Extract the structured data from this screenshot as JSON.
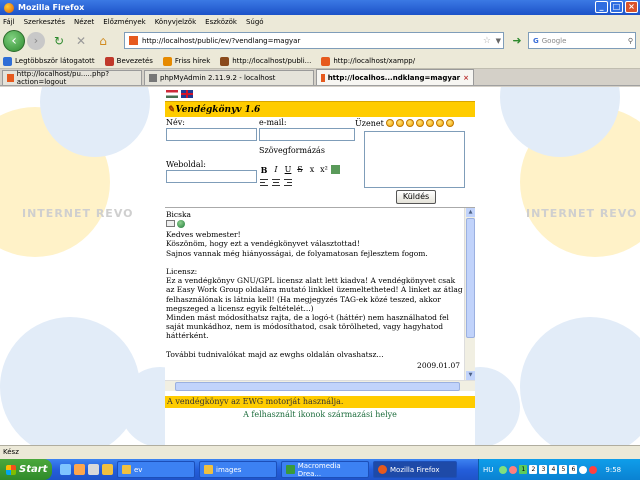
{
  "window": {
    "title": "Mozilla Firefox"
  },
  "menu": [
    "Fájl",
    "Szerkesztés",
    "Nézet",
    "Előzmények",
    "Könyvjelzők",
    "Eszközök",
    "Súgó"
  ],
  "nav": {
    "url": "http://localhost/public/ev/?vendlang=magyar",
    "search_placeholder": "Google"
  },
  "bookmarks": [
    {
      "label": "Legtöbbször látogatott",
      "color": "#2f6ed6"
    },
    {
      "label": "Bevezetés",
      "color": "#c0392b"
    },
    {
      "label": "Friss hírek",
      "color": "#e68a00"
    },
    {
      "label": "http://localhost/publi...",
      "color": "#8a4a1c"
    },
    {
      "label": "http://localhost/xampp/",
      "color": "#e65a1e"
    }
  ],
  "tabs": [
    {
      "label": "http://localhost/pu.....php?action=logout"
    },
    {
      "label": "phpMyAdmin 2.11.9.2 - localhost"
    },
    {
      "label": "http://localhos...ndklang=magyar"
    }
  ],
  "guestbook": {
    "title": "Vendégkönyv 1.6",
    "labels": {
      "name": "Név:",
      "email": "e-mail:",
      "message": "Üzenet",
      "website": "Weboldal:",
      "formatting": "Szövegformázás"
    },
    "format_buttons": [
      "B",
      "I",
      "U",
      "S",
      "x",
      "x²"
    ],
    "send_label": "Küldés",
    "entry": {
      "author": "Bicska",
      "text": "Kedves webmester!\nKöszönöm, hogy ezt a vendégkönyvet választottad!\nSajnos vannak még hiányosságai, de folyamatosan fejlesztem fogom.\n\nLicensz:\nEz a vendégkönyv GNU/GPL licensz alatt lett kiadva! A vendégkönyvet csak az Easy Work Group oldalára mutató linkkel üzemeltetheted! A linket az átlag felhasználónak is látnia kell! (Ha megjegyzés TAG-ek közé teszed, akkor megszeged a licensz egyik feltételét...)\nMinden mást módosíthatsz rajta, de a logó-t (háttér) nem használhatod fel saját munkádhoz, nem is módosíthatod, csak törölheted, vagy hagyhatod háttérként.\n\nTovábbi tudnivalókat majd az ewghs oldalán olvashatsz...",
      "date": "2009.01.07"
    },
    "footer": "A vendégkönyv az EWG motorját használja.",
    "icons_link": "A felhasznált ikonok származási helye"
  },
  "watermark": "INTERNET REVO",
  "status": "Kész",
  "taskbar": {
    "start": "Start",
    "buttons": [
      {
        "label": "ev",
        "color": "#f0c040"
      },
      {
        "label": "images",
        "color": "#f0c040"
      },
      {
        "label": "Macromedia Drea...",
        "color": "#3a9a3a"
      },
      {
        "label": "Mozilla Firefox",
        "color": "#e65a1e"
      }
    ],
    "lang": "HU",
    "desktops": [
      "1",
      "2",
      "3",
      "4",
      "5",
      "6"
    ],
    "clock": "9:58"
  }
}
